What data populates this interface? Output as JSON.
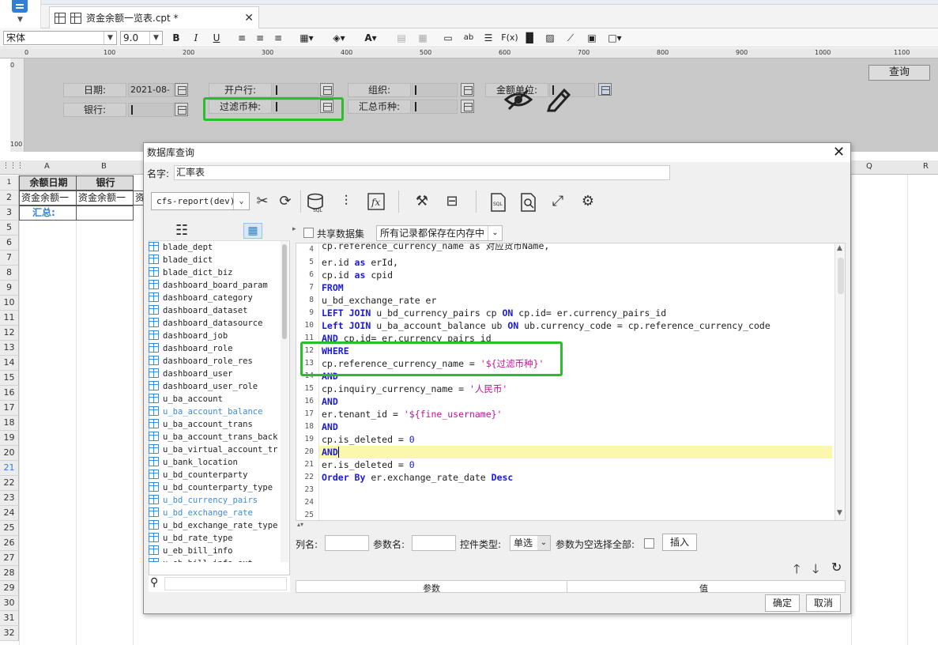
{
  "file_tab": {
    "title": "资金余额一览表.cpt *"
  },
  "format_toolbar": {
    "font_name": "宋体",
    "font_size": "9.0"
  },
  "ruler": {
    "marks": [
      "0",
      "100",
      "200",
      "300",
      "400",
      "500",
      "600",
      "700",
      "800",
      "900",
      "1000",
      "1100"
    ]
  },
  "params": {
    "date_label": "日期:",
    "date_value": "2021-08-",
    "bank_label": "银行:",
    "open_bank_label": "开户行:",
    "filter_currency_label": "过滤币种:",
    "org_label": "组织:",
    "sum_currency_label": "汇总币种:",
    "amount_unit_label": "金额单位:",
    "query_button": "查询"
  },
  "sheet": {
    "columns": [
      "A",
      "B",
      "Q",
      "R"
    ],
    "rows": [
      "1 (Ht)",
      "2",
      "3",
      "5",
      "6",
      "7",
      "8",
      "9",
      "10",
      "11",
      "12",
      "13",
      "14",
      "15",
      "16",
      "17",
      "18",
      "19",
      "20",
      "21",
      "22",
      "23",
      "24",
      "25",
      "26",
      "27",
      "28",
      "29",
      "30",
      "31",
      "32"
    ],
    "a1": "余额日期",
    "b1": "银行",
    "a2": "资金余额一",
    "b2": "资金余额一",
    "c2": "资",
    "a3": "汇总:"
  },
  "dialog": {
    "title": "数据库查询",
    "name_label": "名字:",
    "name_value": "汇率表",
    "datasource": "cfs-report(dev)",
    "shared_dataset_label": "共享数据集",
    "memory_option": "所有记录都保存在内存中",
    "tables": [
      "blade_dept",
      "blade_dict",
      "blade_dict_biz",
      "dashboard_board_param",
      "dashboard_category",
      "dashboard_dataset",
      "dashboard_datasource",
      "dashboard_job",
      "dashboard_role",
      "dashboard_role_res",
      "dashboard_user",
      "dashboard_user_role",
      "u_ba_account",
      "u_ba_account_balance",
      "u_ba_account_trans",
      "u_ba_account_trans_back",
      "u_ba_virtual_account_tran",
      "u_bank_location",
      "u_bd_counterparty",
      "u_bd_counterparty_type",
      "u_bd_currency_pairs",
      "u_bd_exchange_rate",
      "u_bd_exchange_rate_type",
      "u_bd_rate_type",
      "u_eb_bill_info",
      "u_eb_bill_info_ext"
    ],
    "highlighted_tables": [
      "u_ba_account_balance",
      "u_bd_currency_pairs",
      "u_bd_exchange_rate"
    ],
    "line_numbers": [
      "4",
      "5",
      "6",
      "7",
      "8",
      "9",
      "10",
      "11",
      "12",
      "13",
      "14",
      "15",
      "16",
      "17",
      "18",
      "19",
      "20",
      "21",
      "22",
      "23",
      "24",
      "25"
    ],
    "sql": {
      "l4": "cp.reference_currency_name as 对应货币Name,",
      "l5a": "er.id ",
      "l5b": "as",
      "l5c": " erId,",
      "l6a": "cp.id ",
      "l6b": "as",
      "l6c": " cpid",
      "l7": "FROM",
      "l8": "u_bd_exchange_rate er",
      "l9a": "LEFT JOIN",
      "l9b": " u_bd_currency_pairs cp ",
      "l9c": "ON",
      "l9d": " cp.id= er.currency_pairs_id",
      "l10a": "Left JOIN",
      "l10b": " u_ba_account_balance ub ",
      "l10c": "ON",
      "l10d": " ub.currency_code = cp.reference_currency_code",
      "l11a": "AND",
      "l11b": " cp.id= er.currency_pairs_id",
      "l12": "WHERE",
      "l13a": "cp.reference_currency_name = ",
      "l13b": "'${过滤币种}'",
      "l14": "AND",
      "l15a": "cp.inquiry_currency_name = ",
      "l15b": "'人民币'",
      "l16": "AND",
      "l17a": "er.tenant_id = ",
      "l17b": "'${fine_username}'",
      "l18": "AND",
      "l19a": "cp.is_deleted = ",
      "l19b": "0",
      "l20": "AND",
      "l21a": "er.is_deleted = ",
      "l21b": "0",
      "l22a": "Order By",
      "l22b": " er.exchange_rate_date ",
      "l22c": "Desc"
    },
    "column_name_label": "列名:",
    "param_name_label": "参数名:",
    "control_type_label": "控件类型:",
    "control_type_value": "单选",
    "empty_select_all_label": "参数为空选择全部:",
    "insert_button": "插入",
    "grid_headers": [
      "参数",
      "值"
    ],
    "ok_button": "确定",
    "cancel_button": "取消"
  },
  "colors": {
    "accent": "#2f7fd6",
    "highlight_box": "#2bbd2b",
    "keyword": "#1a1ad8",
    "string": "#c0149a",
    "current_line": "#fbf7ad"
  }
}
